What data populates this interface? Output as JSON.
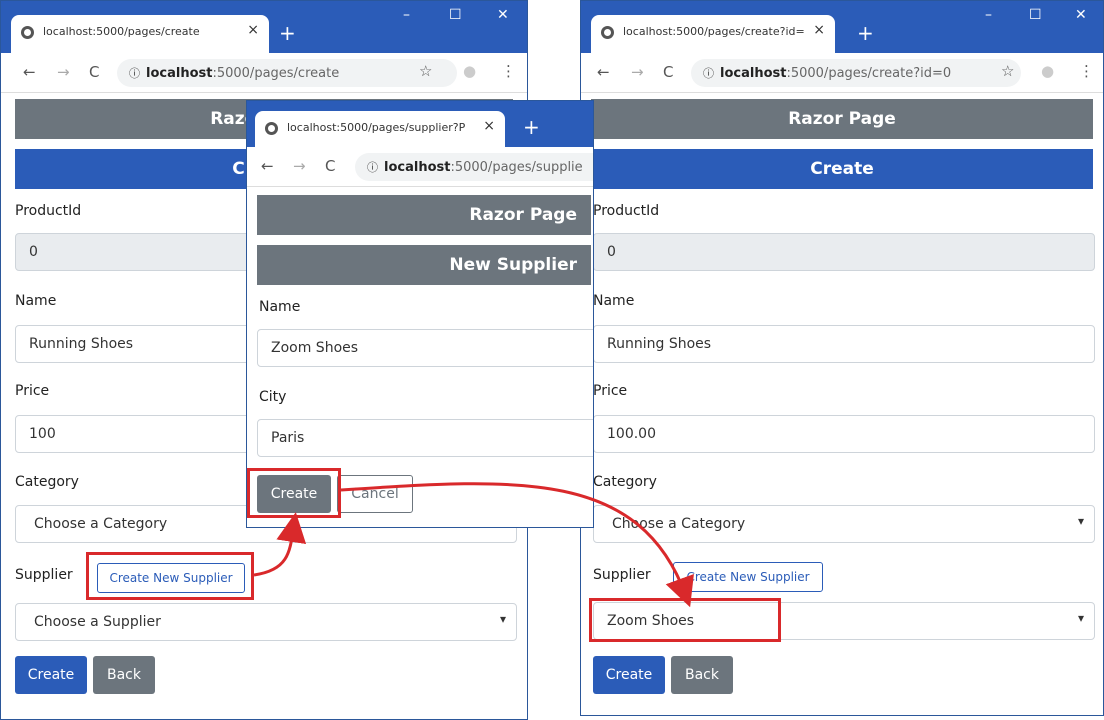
{
  "window1": {
    "tab_title": "localhost:5000/pages/create",
    "url_host": "localhost",
    "url_rest": ":5000/pages/create",
    "header_bar": "Razor Page",
    "action_bar": "Create",
    "productid_label": "ProductId",
    "productid_value": "0",
    "name_label": "Name",
    "name_value": "Running Shoes",
    "price_label": "Price",
    "price_value": "100",
    "category_label": "Category",
    "category_value": "Choose a Category",
    "supplier_label": "Supplier",
    "create_supplier_label": "Create New Supplier",
    "supplier_value": "Choose a Supplier",
    "create_label": "Create",
    "back_label": "Back"
  },
  "window2": {
    "tab_title": "localhost:5000/pages/supplier?P",
    "url_host": "localhost",
    "url_rest": ":5000/pages/supplie",
    "header_bar": "Razor Page",
    "action_bar": "New Supplier",
    "name_label": "Name",
    "name_value": "Zoom Shoes",
    "city_label": "City",
    "city_value": "Paris",
    "create_label": "Create",
    "cancel_label": "Cancel"
  },
  "window3": {
    "tab_title": "localhost:5000/pages/create?id=",
    "url_host": "localhost",
    "url_rest": ":5000/pages/create?id=0",
    "header_bar": "Razor Page",
    "action_bar": "Create",
    "productid_label": "ProductId",
    "productid_value": "0",
    "name_label": "Name",
    "name_value": "Running Shoes",
    "price_label": "Price",
    "price_value": "100.00",
    "category_label": "Category",
    "category_value": "Choose a Category",
    "supplier_label": "Supplier",
    "create_supplier_label": "Create New Supplier",
    "supplier_value": "Zoom Shoes",
    "create_label": "Create",
    "back_label": "Back"
  },
  "icons": {
    "back": "arrow-left",
    "forward": "arrow-right",
    "reload": "reload",
    "info": "info",
    "star": "star",
    "profile": "profile",
    "menu": "kebab-menu"
  },
  "colors": {
    "chrome_blue": "#2b5cb8",
    "bar_gray": "#6c757d",
    "highlight_red": "#d9292b"
  }
}
